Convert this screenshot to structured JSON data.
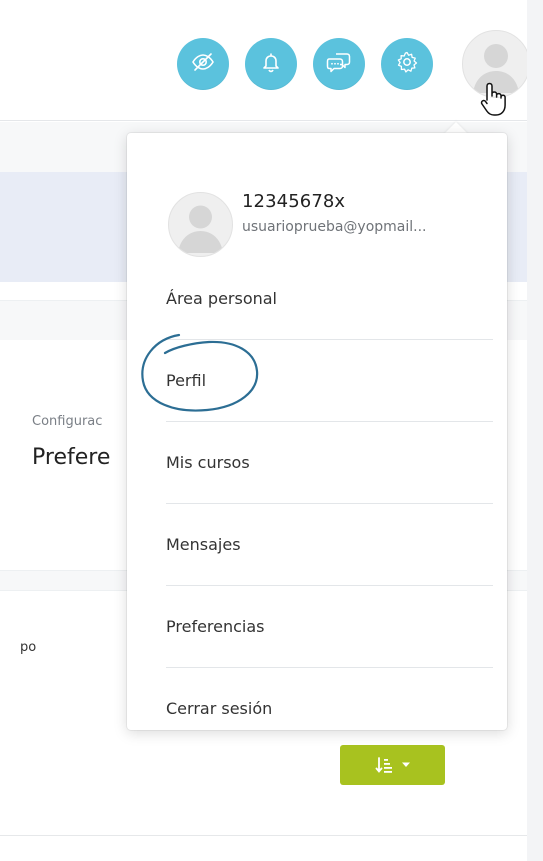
{
  "header": {
    "icons": [
      "eye-slash-icon",
      "bell-icon",
      "chat-icon",
      "gear-icon"
    ],
    "accent_color": "#5bc2dd"
  },
  "content": {
    "config_label": "Configurac",
    "preferences_title": "Prefere",
    "tipo_label": "po",
    "sort_button_color": "#a8c21f"
  },
  "user_menu": {
    "username": "12345678x",
    "email": "usuarioprueba@yopmail...",
    "items": [
      {
        "label": "Área personal"
      },
      {
        "label": "Perfil"
      },
      {
        "label": "Mis cursos"
      },
      {
        "label": "Mensajes"
      },
      {
        "label": "Preferencias"
      },
      {
        "label": "Cerrar sesión"
      }
    ],
    "annotation_color": "#2c6e94"
  }
}
